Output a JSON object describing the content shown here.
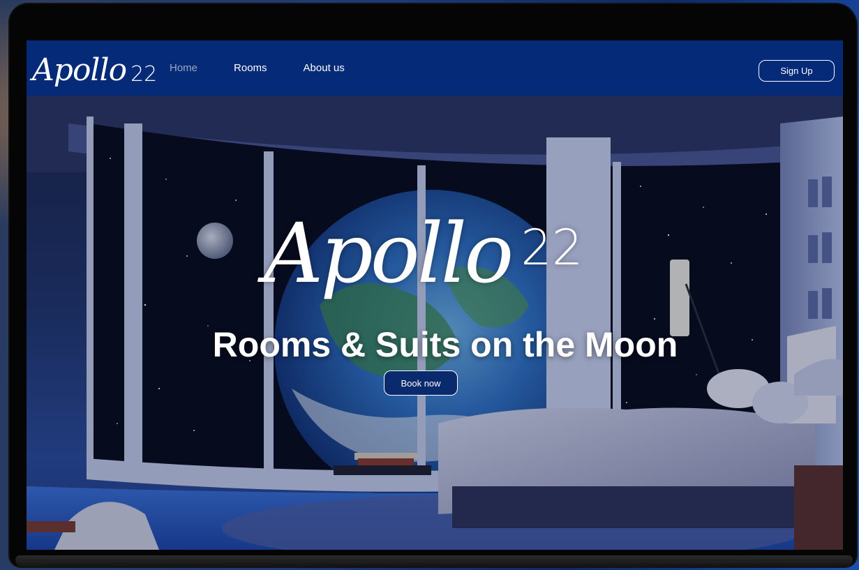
{
  "site": {
    "logo_script": "Apollo",
    "logo_number": "22"
  },
  "nav": {
    "links": [
      {
        "label": "Home",
        "active": true
      },
      {
        "label": "Rooms",
        "active": false
      },
      {
        "label": "About us",
        "active": false
      }
    ],
    "signup_label": "Sign Up"
  },
  "hero": {
    "logo_script": "Apollo",
    "logo_number": "22",
    "title": "Rooms & Suits on the Moon",
    "cta_label": "Book now"
  },
  "colors": {
    "navbar": "#052a78",
    "button_bg": "#0a2a6e",
    "text": "#ffffff",
    "active_link": "#9aa8c4"
  }
}
